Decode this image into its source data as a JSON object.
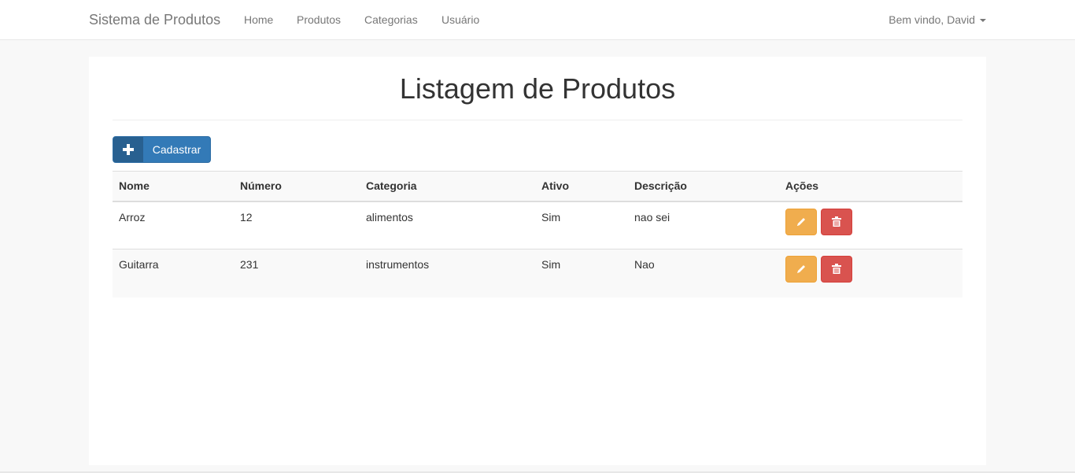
{
  "navbar": {
    "brand": "Sistema de Produtos",
    "items": [
      {
        "label": "Home"
      },
      {
        "label": "Produtos"
      },
      {
        "label": "Categorias"
      },
      {
        "label": "Usuário"
      }
    ],
    "user_label": "Bem vindo, David"
  },
  "main": {
    "title": "Listagem de Produtos",
    "add_button_label": "Cadastrar",
    "add_button_icon": "plus-icon",
    "table": {
      "headers": [
        "Nome",
        "Número",
        "Categoria",
        "Ativo",
        "Descrição",
        "Ações"
      ],
      "rows": [
        {
          "nome": "Arroz",
          "numero": "12",
          "categoria": "alimentos",
          "ativo": "Sim",
          "descricao": "nao sei"
        },
        {
          "nome": "Guitarra",
          "numero": "231",
          "categoria": "instrumentos",
          "ativo": "Sim",
          "descricao": "Nao"
        }
      ],
      "edit_icon": "pencil-icon",
      "delete_icon": "trash-icon"
    }
  },
  "colors": {
    "primary": "#337ab7",
    "warning": "#f0ad4e",
    "danger": "#d9534f"
  }
}
